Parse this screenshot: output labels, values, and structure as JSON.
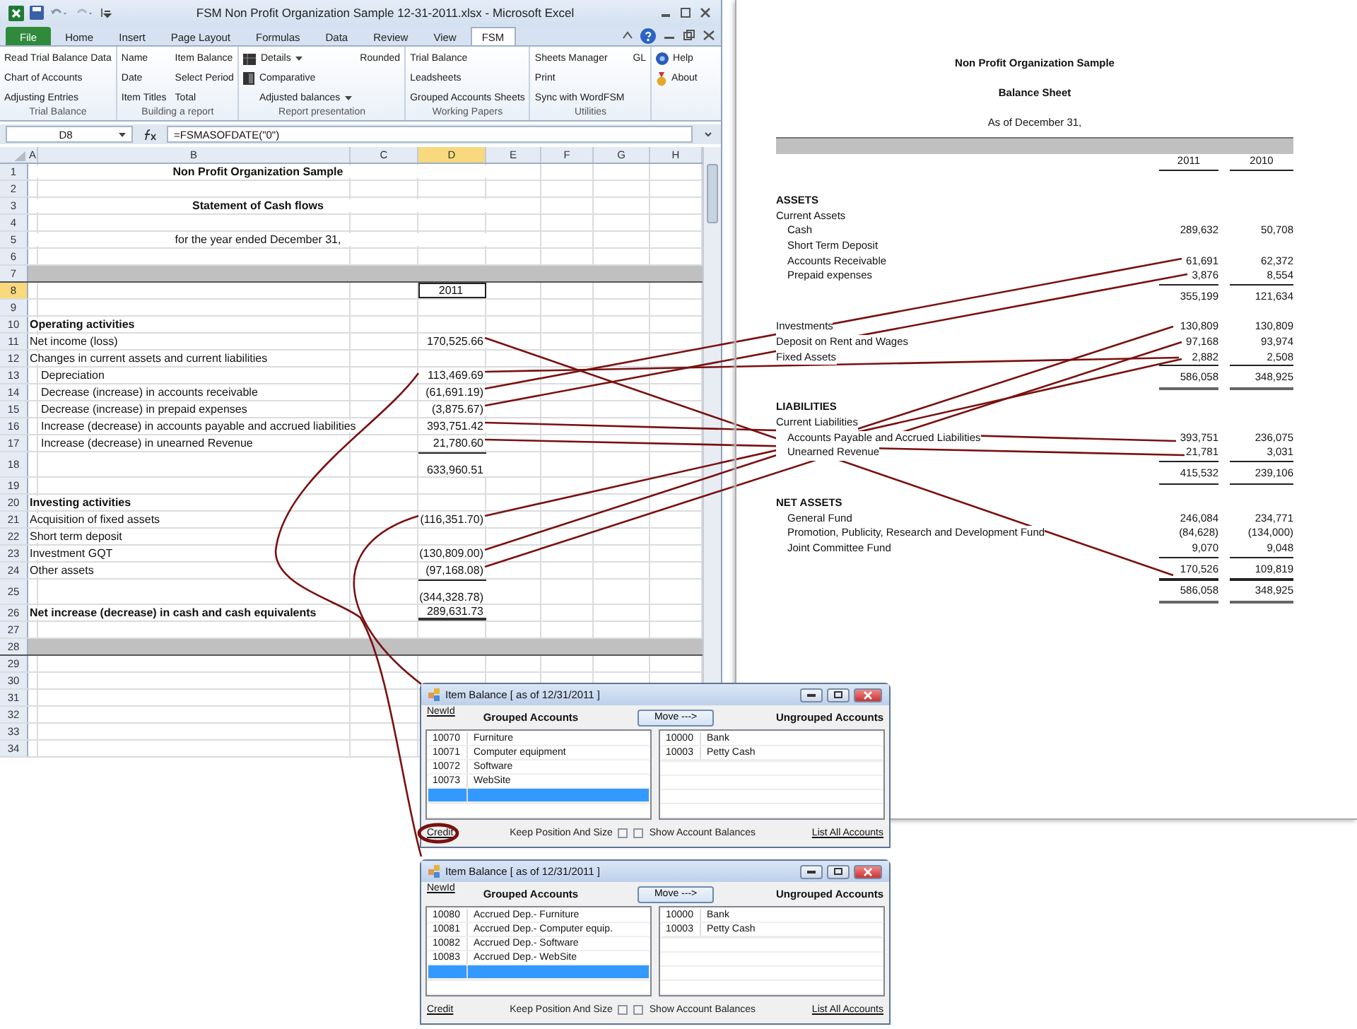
{
  "excel": {
    "title": "FSM Non Profit Organization Sample 12-31-2011.xlsx - Microsoft Excel",
    "tabs": [
      {
        "label": "File",
        "kind": "file",
        "selected": false
      },
      {
        "label": "Home",
        "kind": "tab",
        "selected": false
      },
      {
        "label": "Insert",
        "kind": "tab",
        "selected": false
      },
      {
        "label": "Page Layout",
        "kind": "tab",
        "selected": false
      },
      {
        "label": "Formulas",
        "kind": "tab",
        "selected": false
      },
      {
        "label": "Data",
        "kind": "tab",
        "selected": false
      },
      {
        "label": "Review",
        "kind": "tab",
        "selected": false
      },
      {
        "label": "View",
        "kind": "tab",
        "selected": false
      },
      {
        "label": "FSM",
        "kind": "tab",
        "selected": true
      }
    ],
    "ribbon_groups": [
      {
        "label": "Trial Balance",
        "columns": [
          [
            {
              "label": "Read Trial Balance Data",
              "kind": "text"
            },
            {
              "label": "Chart of Accounts",
              "kind": "text"
            },
            {
              "label": "Adjusting Entries",
              "kind": "text"
            }
          ]
        ]
      },
      {
        "label": "Building a report",
        "columns": [
          [
            {
              "label": "Name",
              "kind": "text"
            },
            {
              "label": "Date",
              "kind": "text"
            },
            {
              "label": "Item Titles",
              "kind": "text"
            }
          ],
          [
            {
              "label": "Item Balance",
              "kind": "text"
            },
            {
              "label": "Select Period",
              "kind": "text"
            },
            {
              "label": "Total",
              "kind": "text"
            }
          ]
        ]
      },
      {
        "label": "Report presentation",
        "columns": [
          [
            {
              "label": "Details",
              "kind": "icon-menu"
            },
            {
              "label": "Comparative",
              "kind": "icon"
            },
            {
              "label": "Adjusted balances",
              "kind": "indent-menu"
            }
          ],
          [
            {
              "label": "Rounded",
              "kind": "text"
            }
          ]
        ]
      },
      {
        "label": "Working Papers",
        "columns": [
          [
            {
              "label": "Trial Balance",
              "kind": "text"
            },
            {
              "label": "Leadsheets",
              "kind": "text"
            },
            {
              "label": "Grouped Accounts Sheets",
              "kind": "text"
            }
          ]
        ]
      },
      {
        "label": "Utilities",
        "columns": [
          [
            {
              "label": "Sheets Manager",
              "kind": "text"
            },
            {
              "label": "Print",
              "kind": "text"
            },
            {
              "label": "Sync with WordFSM",
              "kind": "text"
            }
          ],
          [
            {
              "label": "GL",
              "kind": "text"
            }
          ]
        ]
      },
      {
        "columns": [
          [
            {
              "label": "Help",
              "kind": "icon"
            },
            {
              "label": "About",
              "kind": "icon"
            }
          ]
        ]
      }
    ],
    "name_box": "D8",
    "formula": "=FSMASOFDATE(\"0\")",
    "columns": [
      {
        "label": "A",
        "selected": false
      },
      {
        "label": "B",
        "selected": false
      },
      {
        "label": "C",
        "selected": false
      },
      {
        "label": "D",
        "selected": true
      },
      {
        "label": "E",
        "selected": false
      },
      {
        "label": "F",
        "selected": false
      },
      {
        "label": "G",
        "selected": false
      },
      {
        "label": "H",
        "selected": false
      }
    ],
    "rows": [
      {
        "number": "1",
        "kind": "title",
        "label": "Non Profit Organization Sample",
        "selected": false
      },
      {
        "number": "2",
        "kind": "blank",
        "selected": false
      },
      {
        "number": "3",
        "kind": "title",
        "label": "Statement of Cash flows",
        "selected": false
      },
      {
        "number": "4",
        "kind": "blank",
        "selected": false
      },
      {
        "number": "5",
        "kind": "subtitle",
        "label": "for the year ended December 31,",
        "selected": false
      },
      {
        "number": "6",
        "kind": "blank",
        "selected": false
      },
      {
        "number": "7",
        "kind": "band",
        "selected": false
      },
      {
        "number": "8",
        "kind": "blank",
        "value": "2011",
        "selected": true
      },
      {
        "number": "9",
        "kind": "blank",
        "selected": false
      },
      {
        "number": "10",
        "kind": "heading",
        "label": "Operating activities",
        "selected": false
      },
      {
        "number": "11",
        "kind": "line",
        "label": "Net income (loss)",
        "value": "170,525.66",
        "selected": false
      },
      {
        "number": "12",
        "kind": "line",
        "label": "Changes in current assets and current liabilities",
        "selected": false
      },
      {
        "number": "13",
        "kind": "item",
        "label": "Depreciation",
        "value": "113,469.69",
        "selected": false
      },
      {
        "number": "14",
        "kind": "item",
        "label": "Decrease (increase) in accounts receivable",
        "value": "(61,691.19)",
        "selected": false
      },
      {
        "number": "15",
        "kind": "item",
        "label": "Decrease (increase) in prepaid expenses",
        "value": "(3,875.67)",
        "selected": false
      },
      {
        "number": "16",
        "kind": "item",
        "label": "Increase (decrease) in accounts payable and accrued liabilities",
        "value": "393,751.42",
        "selected": false
      },
      {
        "number": "17",
        "kind": "item",
        "label": "Increase (decrease) in unearned Revenue",
        "value": "21,780.60",
        "selected": false
      },
      {
        "number": "18",
        "kind": "total",
        "value": "633,960.51",
        "selected": false
      },
      {
        "number": "19",
        "kind": "blank",
        "selected": false
      },
      {
        "number": "20",
        "kind": "heading",
        "label": "Investing activities",
        "selected": false
      },
      {
        "number": "21",
        "kind": "line",
        "label": "Acquisition of fixed assets",
        "value": "(116,351.70)",
        "selected": false
      },
      {
        "number": "22",
        "kind": "line",
        "label": "Short term deposit",
        "selected": false
      },
      {
        "number": "23",
        "kind": "line",
        "label": "Investment GQT",
        "value": "(130,809.00)",
        "selected": false
      },
      {
        "number": "24",
        "kind": "line",
        "label": "Other assets",
        "value": "(97,168.08)",
        "selected": false
      },
      {
        "number": "25",
        "kind": "total",
        "value": "(344,328.78)",
        "selected": false
      },
      {
        "number": "26",
        "kind": "grand",
        "label": "Net increase (decrease) in cash and cash equivalents",
        "value": "289,631.73",
        "selected": false
      },
      {
        "number": "27",
        "kind": "blank",
        "selected": false
      },
      {
        "number": "28",
        "kind": "band",
        "selected": false
      },
      {
        "number": "29",
        "kind": "blank",
        "selected": false
      },
      {
        "number": "30",
        "kind": "blank",
        "selected": false
      },
      {
        "number": "31",
        "kind": "blank",
        "selected": false
      },
      {
        "number": "32",
        "kind": "blank",
        "selected": false
      },
      {
        "number": "33",
        "kind": "blank",
        "selected": false
      },
      {
        "number": "34",
        "kind": "blank",
        "selected": false
      }
    ]
  },
  "balance_sheet": {
    "title": "Non Profit Organization Sample",
    "subtitle": "Balance Sheet",
    "date_line": "As of December 31,",
    "years": [
      "2011",
      "2010"
    ],
    "rows": [
      {
        "kind": "section",
        "label": "ASSETS"
      },
      {
        "kind": "group",
        "label": "Current Assets"
      },
      {
        "kind": "item",
        "label": "Cash",
        "values": [
          "289,632",
          "50,708"
        ]
      },
      {
        "kind": "item",
        "label": "Short Term Deposit"
      },
      {
        "kind": "item",
        "label": "Accounts Receivable",
        "values": [
          "61,691",
          "62,372"
        ]
      },
      {
        "kind": "item",
        "label": "Prepaid expenses",
        "values": [
          "3,876",
          "8,554"
        ]
      },
      {
        "kind": "subtotal",
        "values": [
          "355,199",
          "121,634"
        ]
      },
      {
        "kind": "spacer"
      },
      {
        "kind": "group",
        "label": "Investments",
        "values": [
          "130,809",
          "130,809"
        ]
      },
      {
        "kind": "group",
        "label": "Deposit on Rent and Wages",
        "values": [
          "97,168",
          "93,974"
        ]
      },
      {
        "kind": "group",
        "label": "Fixed Assets",
        "values": [
          "2,882",
          "2,508"
        ]
      },
      {
        "kind": "grand",
        "values": [
          "586,058",
          "348,925"
        ]
      },
      {
        "kind": "spacer"
      },
      {
        "kind": "section",
        "label": "LIABILITIES"
      },
      {
        "kind": "group",
        "label": "Current Liabilities"
      },
      {
        "kind": "item",
        "label": "Accounts Payable and Accrued Liabilities",
        "values": [
          "393,751",
          "236,075"
        ]
      },
      {
        "kind": "item",
        "label": "Unearned Revenue",
        "values": [
          "21,781",
          "3,031"
        ]
      },
      {
        "kind": "total",
        "values": [
          "415,532",
          "239,106"
        ]
      },
      {
        "kind": "spacer"
      },
      {
        "kind": "section",
        "label": "NET ASSETS"
      },
      {
        "kind": "item",
        "label": "General Fund",
        "values": [
          "246,084",
          "234,771"
        ]
      },
      {
        "kind": "item",
        "label": "Promotion, Publicity, Research and Development Fund",
        "values": [
          "(84,628)",
          "(134,000)"
        ]
      },
      {
        "kind": "item",
        "label": "Joint Committee Fund",
        "values": [
          "9,070",
          "9,048"
        ]
      },
      {
        "kind": "total",
        "values": [
          "170,526",
          "109,819"
        ]
      },
      {
        "kind": "grand",
        "values": [
          "586,058",
          "348,925"
        ]
      }
    ]
  },
  "dialogs": [
    {
      "title": "Item Balance [ as of 12/31/2011 ]",
      "new_id_link": "NewId",
      "grouped_label": "Grouped Accounts",
      "move_button": "Move --->",
      "ungrouped_label": "Ungrouped Accounts",
      "grouped": [
        {
          "code": "10070",
          "name": "Furniture",
          "selected": false
        },
        {
          "code": "10071",
          "name": "Computer equipment",
          "selected": false
        },
        {
          "code": "10072",
          "name": "Software",
          "selected": false
        },
        {
          "code": "10073",
          "name": "WebSite",
          "selected": false
        },
        {
          "selected": true
        }
      ],
      "ungrouped": [
        {
          "code": "10000",
          "name": "Bank",
          "selected": false
        },
        {
          "code": "10003",
          "name": "Petty Cash",
          "selected": false
        }
      ],
      "credit_link": "Credit",
      "credit_circled": true,
      "keep_position": {
        "label": "Keep Position And Size",
        "checked": false
      },
      "show_balances": {
        "label": "Show Account Balances",
        "checked": false
      },
      "list_all_link": "List All Accounts"
    },
    {
      "title": "Item Balance [ as of 12/31/2011 ]",
      "new_id_link": "NewId",
      "grouped_label": "Grouped Accounts",
      "move_button": "Move --->",
      "ungrouped_label": "Ungrouped Accounts",
      "grouped": [
        {
          "code": "10080",
          "name": "Accrued Dep.- Furniture",
          "selected": false
        },
        {
          "code": "10081",
          "name": "Accrued Dep.- Computer equip.",
          "selected": false
        },
        {
          "code": "10082",
          "name": "Accrued Dep.- Software",
          "selected": false
        },
        {
          "code": "10083",
          "name": "Accrued Dep.- WebSite",
          "selected": false
        },
        {
          "selected": true
        }
      ],
      "ungrouped": [
        {
          "code": "10000",
          "name": "Bank",
          "selected": false
        },
        {
          "code": "10003",
          "name": "Petty Cash",
          "selected": false
        }
      ],
      "credit_link": "Credit",
      "credit_circled": false,
      "keep_position": {
        "label": "Keep Position And Size",
        "checked": false
      },
      "show_balances": {
        "label": "Show Account Balances",
        "checked": false
      },
      "list_all_link": "List All Accounts"
    }
  ]
}
